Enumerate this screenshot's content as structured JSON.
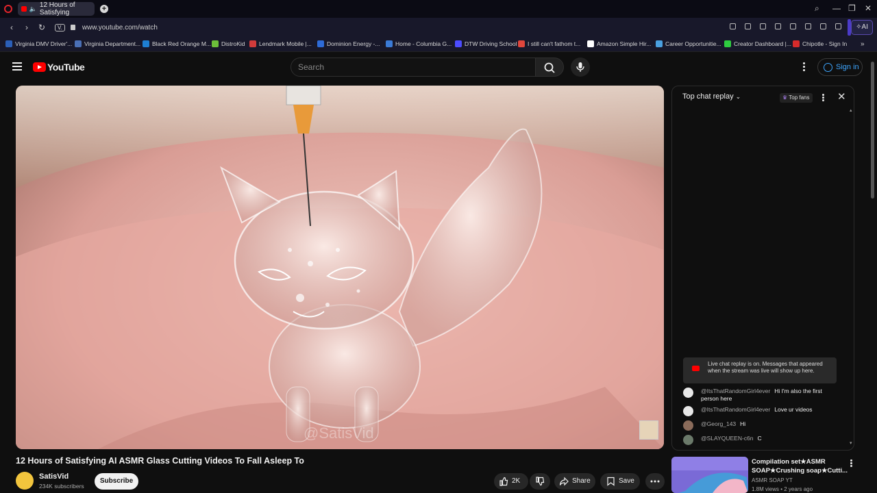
{
  "browser": {
    "tab_title": "12 Hours of Satisfying",
    "url": "www.youtube.com/watch",
    "tab_badge": "V.",
    "ai_label": "AI",
    "bookmarks": [
      "Virginia DMV Driver'...",
      "Virginia Department...",
      "Black Red Orange M...",
      "DistroKid",
      "Lendmark Mobile |...",
      "Dominion Energy -...",
      "Home - Columbia G...",
      "DTW Driving School",
      "I still can't fathom t...",
      "Amazon Simple Hir...",
      "Career Opportunitie...",
      "Creator Dashboard |...",
      "Chipotle - Sign In"
    ],
    "bookmark_colors": [
      "#2b5fb8",
      "#4a6fb5",
      "#1e7ed1",
      "#6cbf3a",
      "#d13b3b",
      "#2e6bd8",
      "#3b7bd6",
      "#4c4cff",
      "#e0463c",
      "#ffffff",
      "#4aa0e0",
      "#2ecc40",
      "#d62b2b"
    ]
  },
  "youtube": {
    "logo_text": "YouTube",
    "search_placeholder": "Search",
    "sign_in": "Sign in"
  },
  "video": {
    "title": "12 Hours of Satisfying AI ASMR Glass Cutting Videos To Fall Asleep To",
    "watermark": "@SatisVid",
    "channel": "SatisVid",
    "subscribers": "234K subscribers",
    "subscribe_label": "Subscribe",
    "likes": "2K",
    "share_label": "Share",
    "save_label": "Save"
  },
  "chat": {
    "header": "Top chat replay",
    "top_fans": "Top fans",
    "notice": "Live chat replay is on. Messages that appeared when the stream was live will show up here.",
    "messages": [
      {
        "author": "@ItsThatRandomGirl4ever",
        "text": "Hi I'm also the first person here"
      },
      {
        "author": "@ItsThatRandomGirl4ever",
        "text": "Love ur videos"
      },
      {
        "author": "@Georg_143",
        "text": "Hi"
      },
      {
        "author": "@SLAYQUEEN-c6n",
        "text": "C"
      }
    ]
  },
  "recommended": {
    "title": "Compilation set★ASMR SOAP★Crushing soap★Cutti...",
    "channel": "ASMR SOAP YT",
    "meta": "1.8M views • 2 years ago"
  }
}
